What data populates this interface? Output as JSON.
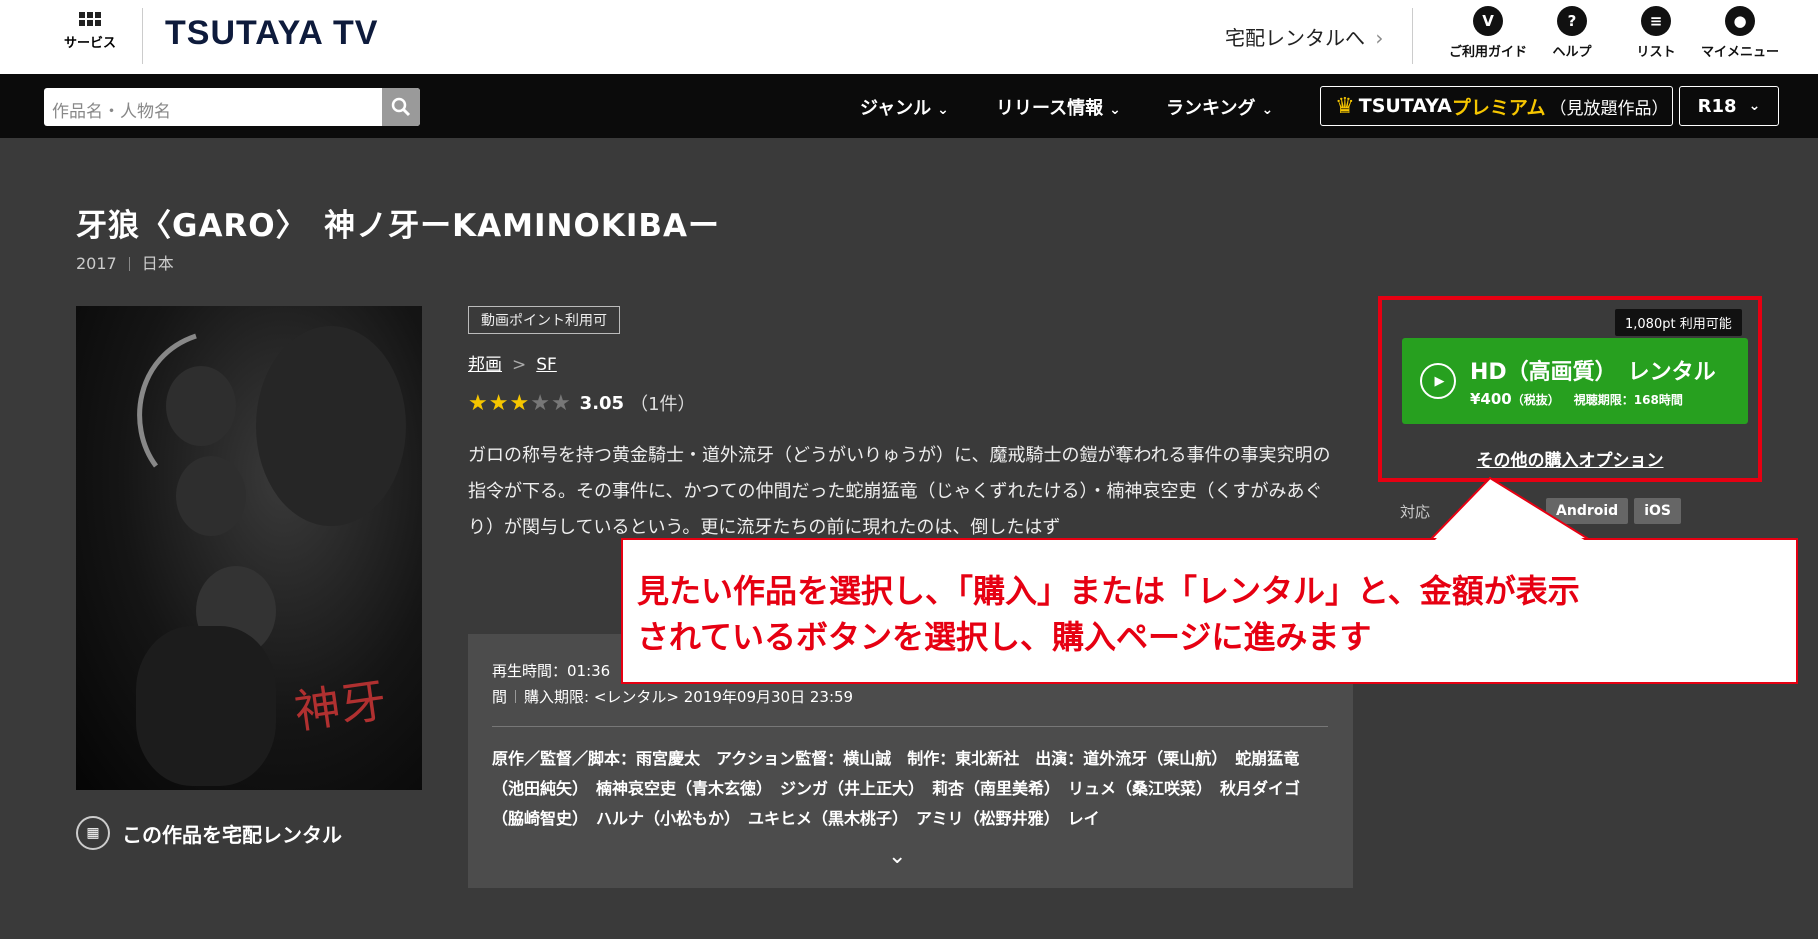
{
  "header": {
    "services_label": "サービス",
    "logo": "TSUTAYA TV",
    "rental_link": "宅配レンタルへ",
    "rental_chevron": "›",
    "icons": [
      {
        "name": "guide-icon",
        "glyph": "V",
        "label": "ご利用ガイド"
      },
      {
        "name": "help-icon",
        "glyph": "?",
        "label": "ヘルプ"
      },
      {
        "name": "list-icon",
        "glyph": "≡",
        "label": "リスト"
      },
      {
        "name": "mymenu-icon",
        "glyph": "●",
        "label": "マイメニュー"
      }
    ]
  },
  "nav": {
    "search_placeholder": "作品名・人物名",
    "genre": "ジャンル",
    "release": "リリース情報",
    "ranking": "ランキング",
    "chevron": "⌄",
    "premium_brand": "TSUTAYA",
    "premium_accent": "プレミアム",
    "premium_note": "（見放題作品）",
    "r18": "R18"
  },
  "work": {
    "title": "牙狼〈GARO〉　神ノ牙ーKAMINOKIBAー",
    "year": "2017",
    "country": "日本",
    "badge": "動画ポイント利用可",
    "breadcrumb": [
      "邦画",
      "SF"
    ],
    "breadcrumb_sep": ">",
    "rating": 3.05,
    "rating_text": "3.05",
    "rating_count": "（1件）",
    "synopsis": "ガロの称号を持つ黄金騎士・道外流牙（どうがいりゅうが）に、魔戒騎士の鎧が奪われる事件の事実究明の指令が下る。その事件に、かつての仲間だった蛇崩猛竜（じゃくずれたける）・楠神哀空吏（くすがみあぐり）が関与しているという。更に流牙たちの前に現れたのは、倒したはず",
    "runtime": "再生時間：01:36",
    "period_prefix": "間",
    "period": "購入期限: <レンタル> 2019年09月30日 23:59",
    "credits": "原作／監督／脚本：雨宮慶太　アクション監督：横山誠　制作：東北新社　出演：道外流牙（栗山航）　蛇崩猛竜（池田純矢）　楠神哀空吏（青木玄徳）　ジンガ（井上正大）　莉杏（南里美希）　リュメ（桑江咲菜）　秋月ダイゴ（脇崎智史）　ハルナ（小松もか）　ユキヒメ（黒木桃子）　アミリ（松野井雅）　レイ",
    "more_chevron": "⌄",
    "poster_calligraphy": "神牙",
    "home_rental": "この作品を宅配レンタル"
  },
  "purchase": {
    "points_badge": "1,080pt 利用可能",
    "play_glyph": "▶",
    "button_title": "HD（高画質）　レンタル",
    "price": "¥400",
    "tax": "（税抜）",
    "limit": "視聴期限：168時間",
    "other_options": "その他の購入オプション"
  },
  "devices": {
    "label": "対応",
    "tags": [
      "Android",
      "iOS"
    ]
  },
  "callout": {
    "line1": "見たい作品を選択し、「購入」または「レンタル」と、金額が表示",
    "line2": "されているボタンを選択し、購入ページに進みます"
  },
  "colors": {
    "accent_red": "#e60012",
    "rental_green": "#27a01f",
    "premium_yellow": "#f6c600",
    "background": "#3a3a3a"
  }
}
